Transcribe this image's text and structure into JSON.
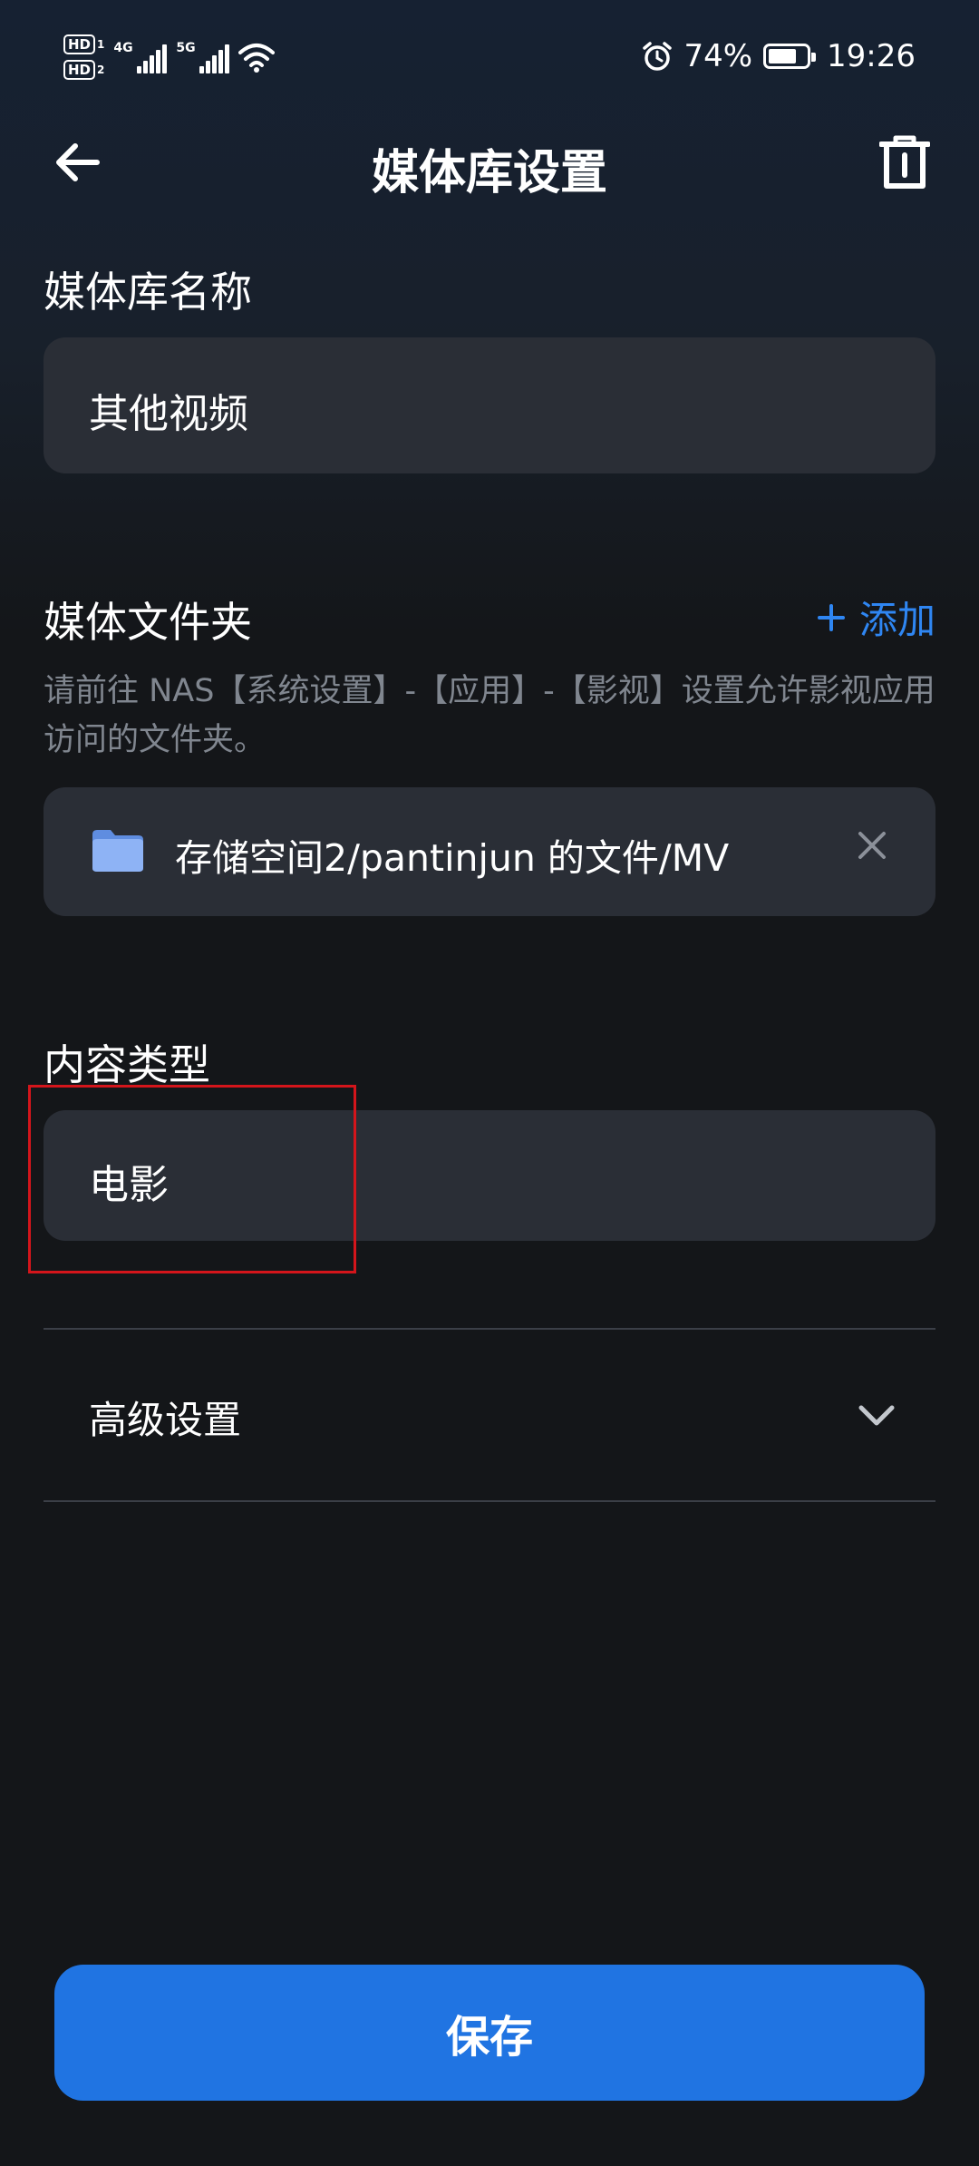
{
  "status_bar": {
    "hd1": "HD",
    "hd1_num": "1",
    "hd2": "HD",
    "hd2_num": "2",
    "signal1_tag": "4G",
    "signal2_tag": "5G",
    "battery_percent": "74%",
    "battery_level": 0.74,
    "time": "19:26"
  },
  "header": {
    "title": "媒体库设置"
  },
  "library_name": {
    "label": "媒体库名称",
    "value": "其他视频"
  },
  "media_folders": {
    "label": "媒体文件夹",
    "add_label": "添加",
    "hint": "请前往 NAS【系统设置】-【应用】-【影视】设置允许影视应用访问的文件夹。",
    "items": [
      {
        "path": "存储空间2/pantinjun 的文件/MV"
      }
    ]
  },
  "content_type": {
    "label": "内容类型",
    "value": "电影"
  },
  "advanced": {
    "label": "高级设置"
  },
  "save_button": {
    "label": "保存"
  },
  "colors": {
    "accent": "#2074e2",
    "link": "#2f86f2",
    "field_bg": "#2a2e36",
    "highlight": "#d4151b",
    "folder": "#7fa7ee"
  }
}
